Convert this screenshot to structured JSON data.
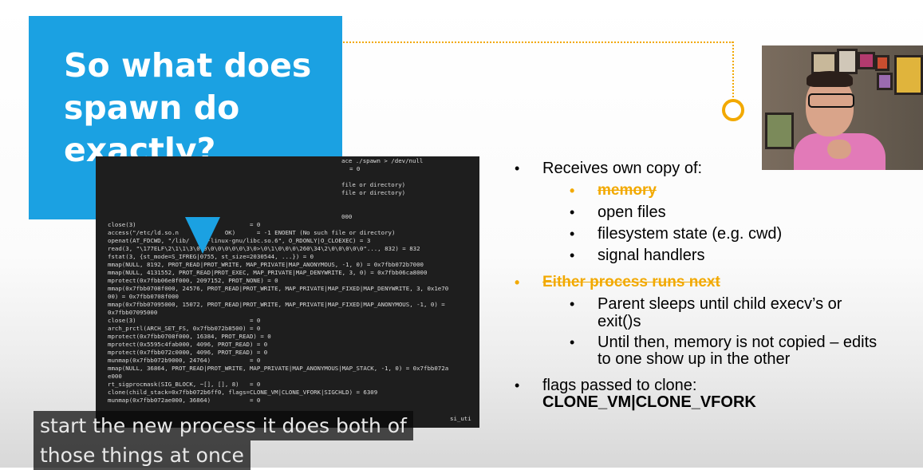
{
  "callout": {
    "title": "So what does spawn do exactly?"
  },
  "terminal": {
    "lines": [
      "ace ./spawn > /dev/null",
      "= 0",
      "file or directory)",
      "file or directory)",
      "000",
      "close(3)                                = 0",
      "access(\"/etc/ld.so.n             OK)      = -1 ENOENT (No such file or directory)",
      "openat(AT_FDCWD, \"/lib/     -linux-gnu/libc.so.6\", O_RDONLY|O_CLOEXEC) = 3",
      "read(3, \"\\177ELF\\2\\1\\1\\3\\0\\0\\0\\0\\0\\0\\0\\3\\0>\\0\\1\\0\\0\\0\\260\\34\\2\\0\\0\\0\\0\\0\"..., 832) = 832",
      "fstat(3, {st_mode=S_IFREG|0755, st_size=2030544, ...}) = 0",
      "mmap(NULL, 8192, PROT_READ|PROT_WRITE, MAP_PRIVATE|MAP_ANONYMOUS, -1, 0) = 0x7fbb072b7000",
      "mmap(NULL, 4131552, PROT_READ|PROT_EXEC, MAP_PRIVATE|MAP_DENYWRITE, 3, 0) = 0x7fbb06ca8000",
      "mprotect(0x7fbb06e8f000, 2097152, PROT_NONE) = 0",
      "mmap(0x7fbb0708f000, 24576, PROT_READ|PROT_WRITE, MAP_PRIVATE|MAP_FIXED|MAP_DENYWRITE, 3, 0x1e70",
      "00) = 0x7fbb0708f000",
      "mmap(0x7fbb07095000, 15072, PROT_READ|PROT_WRITE, MAP_PRIVATE|MAP_FIXED|MAP_ANONYMOUS, -1, 0) =",
      "0x7fbb07095000",
      "close(3)                                = 0",
      "arch_prctl(ARCH_SET_FS, 0x7fbb072b8500) = 0",
      "mprotect(0x7fbb0708f000, 16384, PROT_READ) = 0",
      "mprotect(0x5595c4fab000, 4096, PROT_READ) = 0",
      "mprotect(0x7fbb072c0000, 4096, PROT_READ) = 0",
      "munmap(0x7fbb072b9000, 24764)           = 0",
      "mmap(NULL, 36864, PROT_READ|PROT_WRITE, MAP_PRIVATE|MAP_ANONYMOUS|MAP_STACK, -1, 0) = 0x7fbb072a",
      "e000",
      "rt_sigprocmask(SIG_BLOCK, ~[], [], 8)   = 0",
      "clone(child_stack=0x7fbb072b6ff0, flags=CLONE_VM|CLONE_VFORK|SIGCHLD) = 6309",
      "munmap(0x7fbb072ae000, 36864)           = 0",
      "si_uti"
    ]
  },
  "slide": {
    "b1": "Receives own copy of:",
    "b1_1": "memory",
    "b1_2": "open files",
    "b1_3": "filesystem state (e.g. cwd)",
    "b1_4": "signal handlers",
    "b2": "Either process runs next",
    "b2_1a": "Parent sleeps until child execv’s or",
    "b2_1b": "exit()s",
    "b2_2a": "Until then, memory is not copied – edits",
    "b2_2b": "to one show up in the other",
    "b3": "flags passed to clone:",
    "b3_code": "CLONE_VM|CLONE_VFORK"
  },
  "captions": {
    "line1": "start the new process it does both of",
    "line2": "those things at once"
  },
  "colors": {
    "accent_blue": "#1ba1e2",
    "accent_orange": "#f2a900",
    "terminal_bg": "#1e1e1e"
  }
}
